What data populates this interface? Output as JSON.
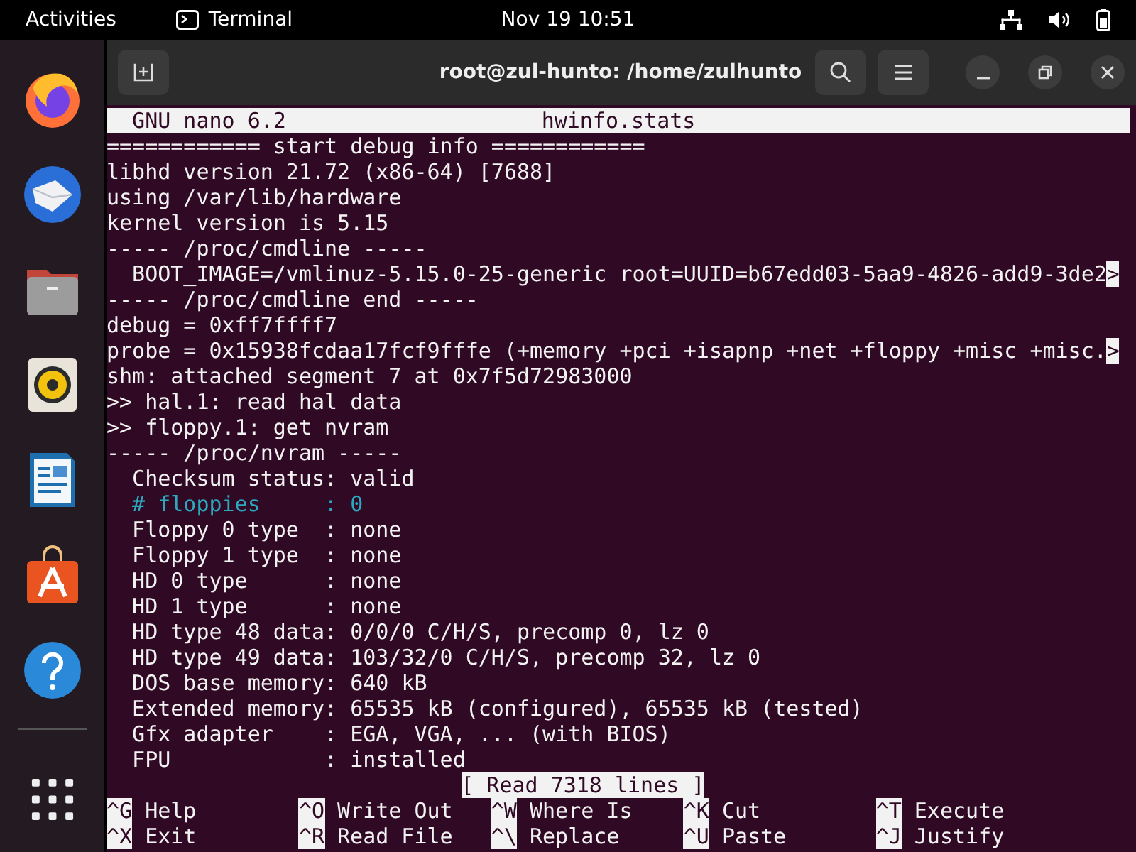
{
  "top_bar": {
    "activities": "Activities",
    "app_name": "Terminal",
    "clock": "Nov 19  10:51"
  },
  "window": {
    "title": "root@zul-hunto: /home/zulhunto"
  },
  "nano": {
    "version": "GNU nano 6.2",
    "filename": "hwinfo.stats",
    "lines": [
      {
        "text": "============ start debug info ============",
        "kind": "plain"
      },
      {
        "text": "libhd version 21.72 (x86-64) [7688]",
        "kind": "plain"
      },
      {
        "text": "using /var/lib/hardware",
        "kind": "plain"
      },
      {
        "text": "kernel version is 5.15",
        "kind": "plain"
      },
      {
        "text": "----- /proc/cmdline -----",
        "kind": "plain"
      },
      {
        "text": "  BOOT_IMAGE=/vmlinuz-5.15.0-25-generic root=UUID=b67edd03-5aa9-4826-add9-3de2",
        "kind": "plain",
        "more": ">"
      },
      {
        "text": "----- /proc/cmdline end -----",
        "kind": "plain"
      },
      {
        "text": "debug = 0xff7ffff7",
        "kind": "plain"
      },
      {
        "text": "probe = 0x15938fcdaa17fcf9fffe (+memory +pci +isapnp +net +floppy +misc +misc.",
        "kind": "plain",
        "more": ">"
      },
      {
        "text": "shm: attached segment 7 at 0x7f5d72983000",
        "kind": "plain"
      },
      {
        "text": ">> hal.1: read hal data",
        "kind": "plain"
      },
      {
        "text": ">> floppy.1: get nvram",
        "kind": "plain"
      },
      {
        "text": "----- /proc/nvram -----",
        "kind": "plain"
      },
      {
        "text": "  Checksum status: valid",
        "kind": "plain"
      },
      {
        "text": "  # floppies     : 0",
        "kind": "comment"
      },
      {
        "text": "  Floppy 0 type  : none",
        "kind": "plain"
      },
      {
        "text": "  Floppy 1 type  : none",
        "kind": "plain"
      },
      {
        "text": "  HD 0 type      : none",
        "kind": "plain"
      },
      {
        "text": "  HD 1 type      : none",
        "kind": "plain"
      },
      {
        "text": "  HD type 48 data: 0/0/0 C/H/S, precomp 0, lz 0",
        "kind": "plain"
      },
      {
        "text": "  HD type 49 data: 103/32/0 C/H/S, precomp 32, lz 0",
        "kind": "plain"
      },
      {
        "text": "  DOS base memory: 640 kB",
        "kind": "plain"
      },
      {
        "text": "  Extended memory: 65535 kB (configured), 65535 kB (tested)",
        "kind": "plain"
      },
      {
        "text": "  Gfx adapter    : EGA, VGA, ... (with BIOS)",
        "kind": "plain"
      },
      {
        "text": "  FPU            : installed",
        "kind": "plain"
      }
    ],
    "status": "[ Read 7318 lines ]",
    "shortcuts": [
      {
        "key": "^G",
        "label": "Help"
      },
      {
        "key": "^O",
        "label": "Write Out"
      },
      {
        "key": "^W",
        "label": "Where Is"
      },
      {
        "key": "^K",
        "label": "Cut"
      },
      {
        "key": "^T",
        "label": "Execute"
      },
      {
        "key": "^X",
        "label": "Exit"
      },
      {
        "key": "^R",
        "label": "Read File"
      },
      {
        "key": "^\\",
        "label": "Replace"
      },
      {
        "key": "^U",
        "label": "Paste"
      },
      {
        "key": "^J",
        "label": "Justify"
      }
    ]
  }
}
